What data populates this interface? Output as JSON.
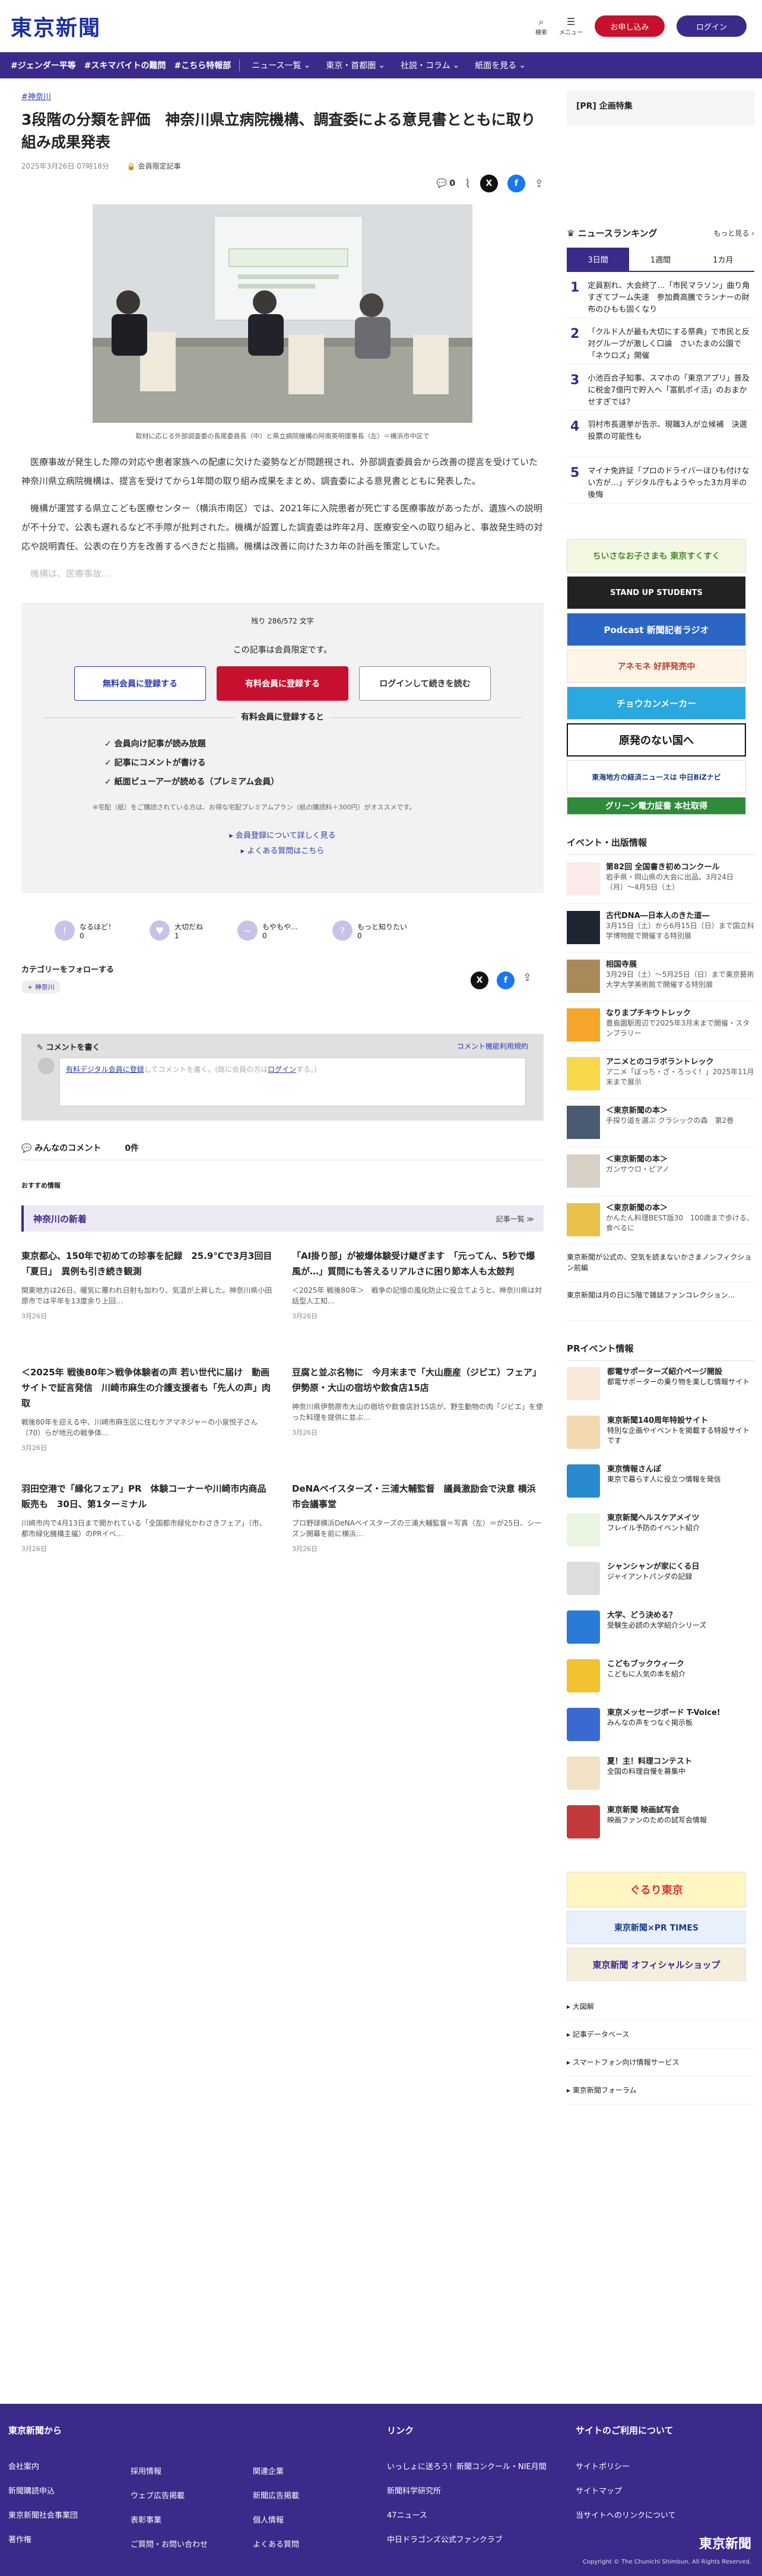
{
  "header": {
    "logo": "東京新聞",
    "search": "検索",
    "menu": "メニュー",
    "signup": "お申し込み",
    "login": "ログイン"
  },
  "nav": {
    "tags": [
      "#ジェンダー平等",
      "#スキマバイトの難問",
      "#こちら特報部"
    ],
    "cats": [
      "ニュース一覧",
      "東京・首都圏",
      "社説・コラム",
      "紙面を見る"
    ]
  },
  "article": {
    "crumb": "#神奈川",
    "title": "3段階の分類を評価　神奈川県立病院機構、調査委による意見書とともに取り組み成果発表",
    "date": "2025年3月26日 07時18分",
    "member": "会員限定記事",
    "comments": "0",
    "caption": "取材に応じる外部調査委の長尾委員長（中）と県立病院機構の阿南英明理事長（左）＝横浜市中区で",
    "p1": "医療事故が発生した際の対応や患者家族への配慮に欠けた姿勢などが問題視され、外部調査委員会から改善の提言を受けていた神奈川県立病院機構は、提言を受けてから1年間の取り組み成果をまとめ、調査委による意見書とともに発表した。",
    "p2": "機構が運営する県立こども医療センター（横浜市南区）では、2021年に入院患者が死亡する医療事故があったが、遺族への説明が不十分で、公表も遅れるなど不手際が批判された。機構が設置した調査委は昨年2月、医療安全への取り組みと、事故発生時の対応や説明責任、公表の在り方を改善するべきだと指摘。機構は改善に向けた3カ年の計画を策定していた。",
    "p3": "機構は、医療事故..."
  },
  "paywall": {
    "remain": "残り 286/572 文字",
    "msg": "この記事は会員限定です。",
    "free": "無料会員に登録する",
    "paid": "有料会員に登録する",
    "login": "ログインして続きを読む",
    "benefit": "有料会員に登録すると",
    "list": [
      "会員向け記事が読み放題",
      "記事にコメントが書ける",
      "紙面ビューアーが読める（プレミアム会員）"
    ],
    "note": "※宅配（紙）をご購読されている方は、お得な宅配プレミアムプラン（紙の購読料＋300円）がオススメです。",
    "more": "会員登録について詳しく見る",
    "faq": "よくある質問はこちら"
  },
  "reactions": [
    {
      "label": "なるほど！",
      "n": "0"
    },
    {
      "label": "大切だね",
      "n": "1"
    },
    {
      "label": "もやもや…",
      "n": "0"
    },
    {
      "label": "もっと知りたい",
      "n": "0"
    }
  ],
  "follow": {
    "label": "カテゴリーをフォローする",
    "tag": "神奈川"
  },
  "comment": {
    "title": "コメントを書く",
    "help": "コメント機能利用規約",
    "placeholder_pre": "有料デジタル会員に登録",
    "placeholder": "してコメントを書く。(既に会員の方は",
    "login": "ログイン",
    "end": "する。)",
    "all": "みんなのコメント",
    "count": "0件"
  },
  "recommend": "おすすめ情報",
  "news": {
    "title": "神奈川の新着",
    "more": "記事一覧 ≫",
    "items": [
      {
        "t": "東京都心、150年で初めての珍事を記録　25.9℃で3月3回目「夏日」　異例も引き続き観測",
        "d": "関東地方は26日、暖気に覆われ日射も加わり、気温が上昇した。神奈川県小田原市では平年を13度余り上回…",
        "dt": "3月26日"
      },
      {
        "t": "「AI掛り部」が被爆体験受け継ぎます　「元ってん、5秒で爆風が…」質問にも答えるリアルさに困り節本人も太鼓判",
        "d": "＜2025年 戦後80年＞　戦争の記憶の風化防止に役立てようと、神奈川県は対話型人工知…",
        "dt": "3月26日"
      },
      {
        "t": "＜2025年 戦後80年＞戦争体験者の声 若い世代に届け　動画サイトで証言発信　川崎市麻生の介護支援者も「先人の声」肉取",
        "d": "戦後80年を迎える中、川崎市麻生区に住むケアマネジャーの小泉悦子さん（70）らが地元の戦争体…",
        "dt": "3月26日"
      },
      {
        "t": "豆腐と並ぶ名物に　今月末まで「大山鹿産（ジビエ）フェア」　伊勢原・大山の宿坊や飲食店15店",
        "d": "神奈川県伊勢原市大山の宿坊や飲食店計15店が、野生動物の肉「ジビエ」を使った料理を提供に並ぶ…",
        "dt": "3月26日"
      },
      {
        "t": "羽田空港で「縁化フェア」PR　体験コーナーや川崎市内商品販売も　30日、第1ターミナル",
        "d": "川崎市内で4月13日まで開かれている「全国都市緑化かわさきフェア」（市、都市緑化機構主催）のPRイベ…",
        "dt": "3月26日"
      },
      {
        "t": "DeNAベイスターズ・三浦大輔監督　議員激励会で決意 横浜市会議事堂",
        "d": "プロ野球横浜DeNAベイスターズの三浦大輔監督＝写真（左）＝が25日、シーズン開幕を前に横浜…",
        "dt": "3月26日"
      }
    ]
  },
  "side": {
    "pr": "[PR] 企画特集",
    "ranking": "ニュースランキング",
    "rk_more": "もっと見る ›",
    "tabs": [
      "3日間",
      "1週間",
      "1カ月"
    ],
    "rank": [
      "定員割れ、大会終了…「市民マラソン」曲り角すぎてブーム失速　参加費高騰でランナーの財布のひもも固くなり",
      "「クルド人が最も大切にする祭典」で市民と反対グループが激しく口論　さいたまの公園で「ネウロズ」開催",
      "小池百合子知事、スマホの「東京アプリ」普及に税金7億円で貯入へ「冨飢ポイ活」のおまかせすぎでは？",
      "羽村市長選挙が告示、現職3人が立候補　決選投票の可能性も",
      "マイナ免許証「プロのドライバーほひも付けない方が…」デジタル庁もようやった3カ月半の後悔"
    ],
    "banners": [
      "ちいさなお子さまも 東京すくすく",
      "STAND UP STUDENTS",
      "Podcast 新聞記者ラジオ",
      "アネモネ 好評発売中",
      "チョウカンメーカー",
      "原発のない国へ",
      "東海地方の経済ニュースは 中日BiZナビ",
      "グリーン電力証書 本社取得"
    ],
    "events_h": "イベント・出版情報",
    "events": [
      {
        "t": "第82回 全国書き初めコンクール",
        "d": "岩手県・岡山県の大会に出品。3月24日（月）〜4月5日（土）"
      },
      {
        "t": "古代DNA―日本人のきた道―",
        "d": "3月15日（土）から6月15日（日）まで国立科学博物館で開催する特別展"
      },
      {
        "t": "相国寺展",
        "d": "3月29日（土）〜5月25日（日）まで東京藝術大学大学美術館で開催する特別展"
      },
      {
        "t": "なりまプチキウトレック",
        "d": "豊島園駅周辺で2025年3月末まで開催・スタンプラリー"
      },
      {
        "t": "アニメとのコラボラントレック",
        "d": "アニメ「ぼっち・ざ・ろっく！」2025年11月末まで展示"
      },
      {
        "t": "＜東京新聞の本＞",
        "d": "手探り道を選ぶ クラシックの森　第2巻"
      },
      {
        "t": "＜東京新聞の本＞",
        "d": "ガンサウロ・ピアノ"
      },
      {
        "t": "＜東京新聞の本＞",
        "d": "かんたん料理BEST版30　100歳まで歩ける、食べるに"
      }
    ],
    "links": [
      "東京新聞が公式の、空気を読まないかさまノンフィクション前編",
      "東京新聞は月の日に5階で雑誌ファンコレクション…"
    ],
    "pr_h": "PRイベント情報",
    "prs": [
      {
        "t": "都電サポーターズ紹介ページ開設",
        "d": "都電サポーターの乗り物を楽しむ情報サイト"
      },
      {
        "t": "東京新聞140周年特設サイト",
        "d": "特別な企画やイベントを掲載する特設サイトです"
      },
      {
        "t": "東京情報さんぽ",
        "d": "東京で暮らす人に役立つ情報を発信"
      },
      {
        "t": "東京新聞ヘルスケアメイツ",
        "d": "フレイル予防のイベント紹介"
      },
      {
        "t": "シャンシャンが家にくる日",
        "d": "ジャイアントパンダの記録"
      },
      {
        "t": "大学、どう決める？",
        "d": "受験生必読の大学紹介シリーズ"
      },
      {
        "t": "こどもブックウィーク",
        "d": "こどもに人気の本を紹介"
      },
      {
        "t": "東京メッセージボード T-Voice!",
        "d": "みんなの声をつなぐ掲示板"
      },
      {
        "t": "夏！主！料理コンテスト",
        "d": "全国の料理自慢を募集中"
      },
      {
        "t": "東京新聞 映画試写会",
        "d": "映画ファンのための試写会情報"
      }
    ],
    "bottom_banners": [
      "ぐるり東京",
      "東京新聞×PR TIMES",
      "東京新聞 オフィシャルショップ"
    ],
    "tail_links": [
      "大図解",
      "記事データベース",
      "スマートフォン向け情報サービス",
      "東京新聞フォーラム"
    ]
  },
  "footer": {
    "c1": {
      "h": "東京新聞から",
      "items": [
        "会社案内",
        "新聞購読申込",
        "東京新聞社会事業団",
        "著作権"
      ]
    },
    "c2": {
      "h": "",
      "items": [
        "採用情報",
        "ウェブ広告掲載",
        "表彰事業",
        "ご質問・お問い合わせ"
      ]
    },
    "c3": {
      "h": "",
      "items": [
        "関連企業",
        "新聞広告掲載",
        "個人情報",
        "よくある質問"
      ]
    },
    "c4": {
      "h": "リンク",
      "items": [
        "いっしょに送ろう！新聞コンクール・NIE月間",
        "新聞科学研究所",
        "47ニュース",
        "中日ドラゴンズ公式ファンクラブ"
      ]
    },
    "c5": {
      "h": "サイトのご利用について",
      "items": [
        "サイトポリシー",
        "サイトマップ",
        "当サイトへのリンクについて"
      ]
    },
    "logo": "東京新聞",
    "copy": "Copyright © The Chunichi Shimbun, All Rights Reserved."
  }
}
